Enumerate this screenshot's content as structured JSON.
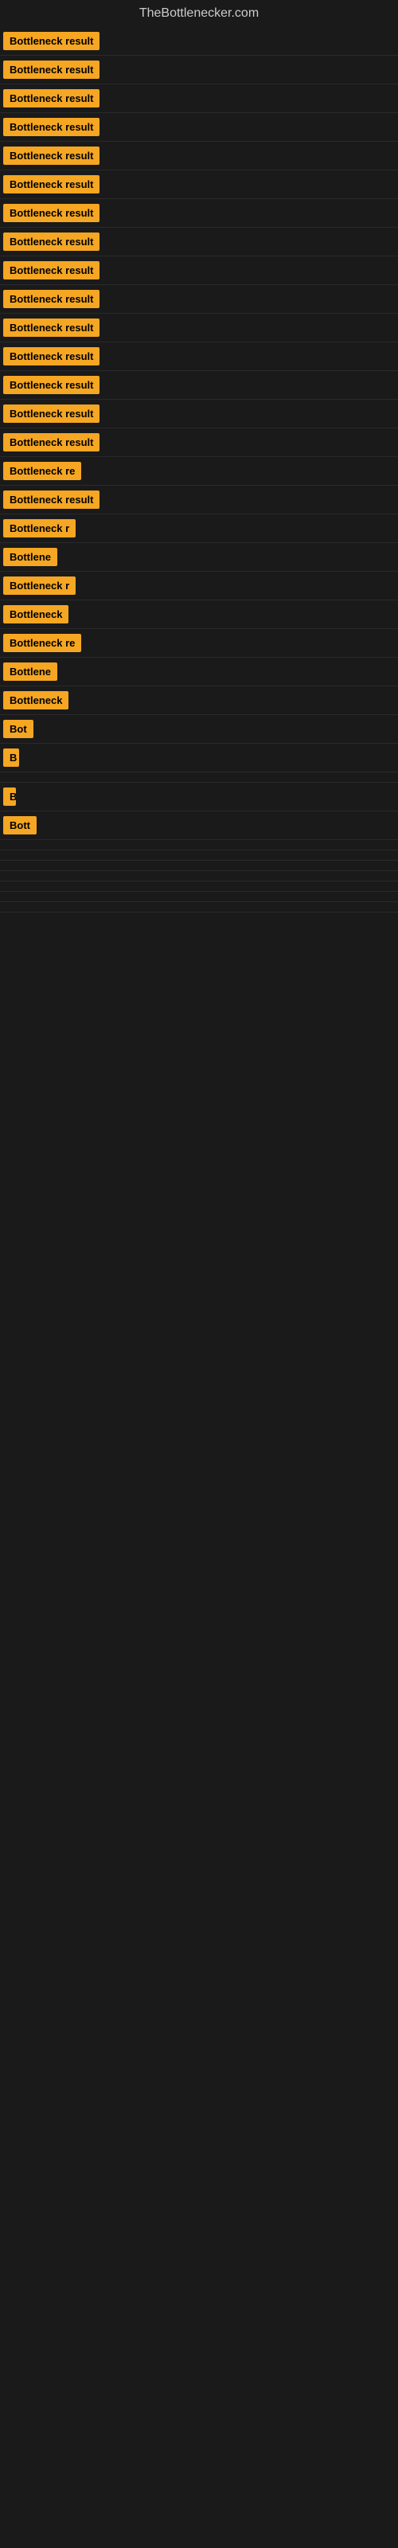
{
  "header": {
    "title": "TheBottlenecker.com"
  },
  "rows": [
    {
      "label": "Bottleneck result",
      "width": 145
    },
    {
      "label": "Bottleneck result",
      "width": 145
    },
    {
      "label": "Bottleneck result",
      "width": 145
    },
    {
      "label": "Bottleneck result",
      "width": 145
    },
    {
      "label": "Bottleneck result",
      "width": 145
    },
    {
      "label": "Bottleneck result",
      "width": 145
    },
    {
      "label": "Bottleneck result",
      "width": 145
    },
    {
      "label": "Bottleneck result",
      "width": 145
    },
    {
      "label": "Bottleneck result",
      "width": 145
    },
    {
      "label": "Bottleneck result",
      "width": 145
    },
    {
      "label": "Bottleneck result",
      "width": 145
    },
    {
      "label": "Bottleneck result",
      "width": 145
    },
    {
      "label": "Bottleneck result",
      "width": 145
    },
    {
      "label": "Bottleneck result",
      "width": 145
    },
    {
      "label": "Bottleneck result",
      "width": 145
    },
    {
      "label": "Bottleneck re",
      "width": 110
    },
    {
      "label": "Bottleneck result",
      "width": 140
    },
    {
      "label": "Bottleneck r",
      "width": 100
    },
    {
      "label": "Bottlene",
      "width": 80
    },
    {
      "label": "Bottleneck r",
      "width": 100
    },
    {
      "label": "Bottleneck",
      "width": 90
    },
    {
      "label": "Bottleneck re",
      "width": 110
    },
    {
      "label": "Bottlene",
      "width": 80
    },
    {
      "label": "Bottleneck",
      "width": 90
    },
    {
      "label": "Bot",
      "width": 40
    },
    {
      "label": "B",
      "width": 20
    },
    {
      "label": "",
      "width": 0
    },
    {
      "label": "B",
      "width": 16
    },
    {
      "label": "Bott",
      "width": 45
    },
    {
      "label": "",
      "width": 0
    },
    {
      "label": "",
      "width": 0
    },
    {
      "label": "",
      "width": 0
    },
    {
      "label": "",
      "width": 0
    },
    {
      "label": "",
      "width": 0
    },
    {
      "label": "",
      "width": 0
    },
    {
      "label": "",
      "width": 0
    }
  ]
}
